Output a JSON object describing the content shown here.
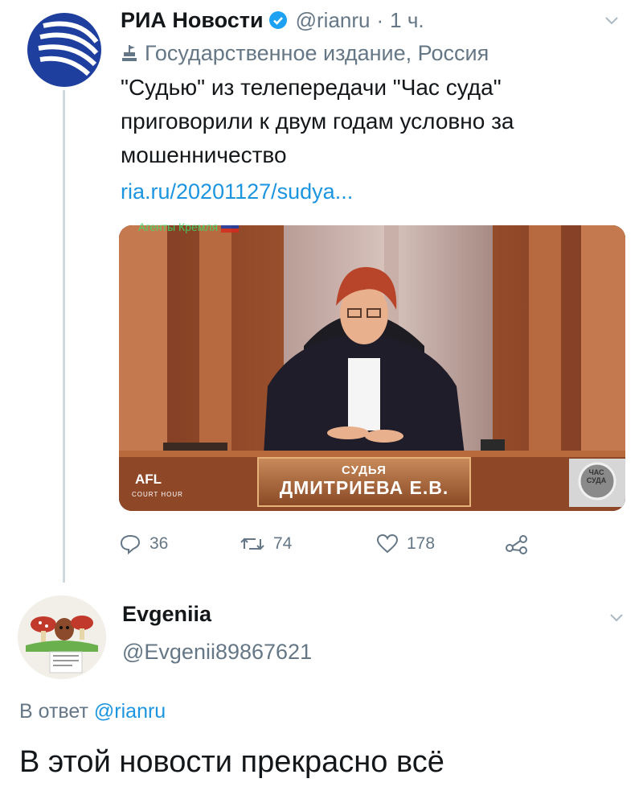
{
  "tweet": {
    "author_name": "РИА Новости",
    "handle": "@rianru",
    "separator": "·",
    "time": "1 ч.",
    "label": "Государственное издание, Россия",
    "text": "\"Судью\" из телепередачи \"Час суда\" приговорили к двум годам условно за мошенничество",
    "link": "ria.ru/20201127/sudya...",
    "media": {
      "watermark": "Агенты Кремля",
      "caption_small": "СУДЬЯ",
      "caption_big": "ДМИТРИЕВА Е.В.",
      "logo_left": "AFL",
      "logo_left_sub": "COURT HOUR",
      "logo_right": "ЧАС СУДА"
    },
    "actions": {
      "replies": "36",
      "retweets": "74",
      "likes": "178"
    }
  },
  "reply": {
    "author_name": "Evgeniia",
    "handle": "@Evgenii89867621",
    "reply_to_prefix": "В ответ",
    "reply_to_handle": "@rianru",
    "text": "В этой новости прекрасно всё"
  },
  "colors": {
    "link": "#1b95e0",
    "secondary_text": "#657786",
    "verified": "#1da1f2",
    "ria_blue": "#1f3f9f"
  }
}
